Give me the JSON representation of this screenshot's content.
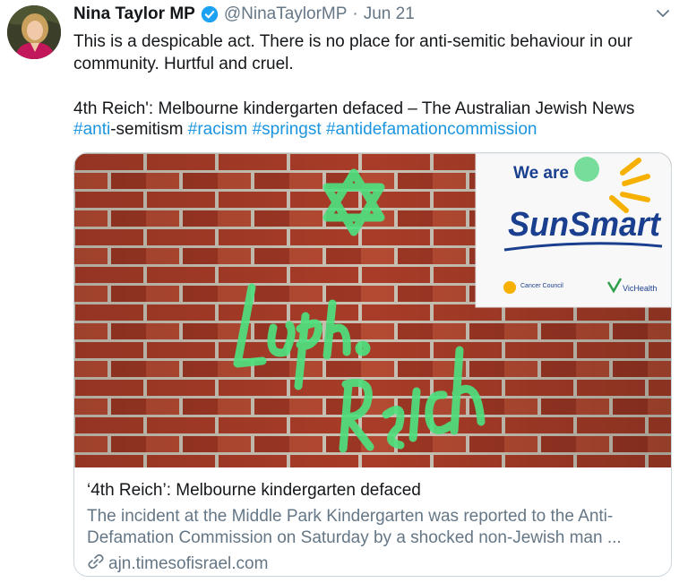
{
  "author": {
    "name": "Nina Taylor MP",
    "handle": "@NinaTaylorMP",
    "separator": "·",
    "date": "Jun 21"
  },
  "tweet": {
    "text": "This is a despicable act. There is no place for anti-semitic behaviour in our community. Hurtful and cruel.\n\n4th Reich': Melbourne kindergarten defaced – The Australian Jewish News",
    "hashtag_1": "#anti",
    "plain_1": "-semitism ",
    "hashtag_2": "#racism",
    "hashtag_3": "#springst",
    "hashtag_4": "#antidefamationcommission"
  },
  "card": {
    "sign": {
      "line1": "We are",
      "brand": "SunSmart",
      "sponsor1": "Cancer Council",
      "sponsor2": "VicHealth"
    },
    "title": "‘4th Reich’: Melbourne kindergarten defaced",
    "description": "The incident at the Middle Park Kindergarten was reported to the Anti-Defamation Commission on Saturday by a shocked non-Jewish man ...",
    "domain": "ajn.timesofisrael.com"
  },
  "icons": {
    "verified": "verified-badge-icon",
    "more": "chevron-down-icon",
    "link": "link-icon"
  },
  "colors": {
    "link": "#1b95e0",
    "secondary": "#657786",
    "verified": "#1da1f2",
    "border": "#ccd6dd"
  }
}
